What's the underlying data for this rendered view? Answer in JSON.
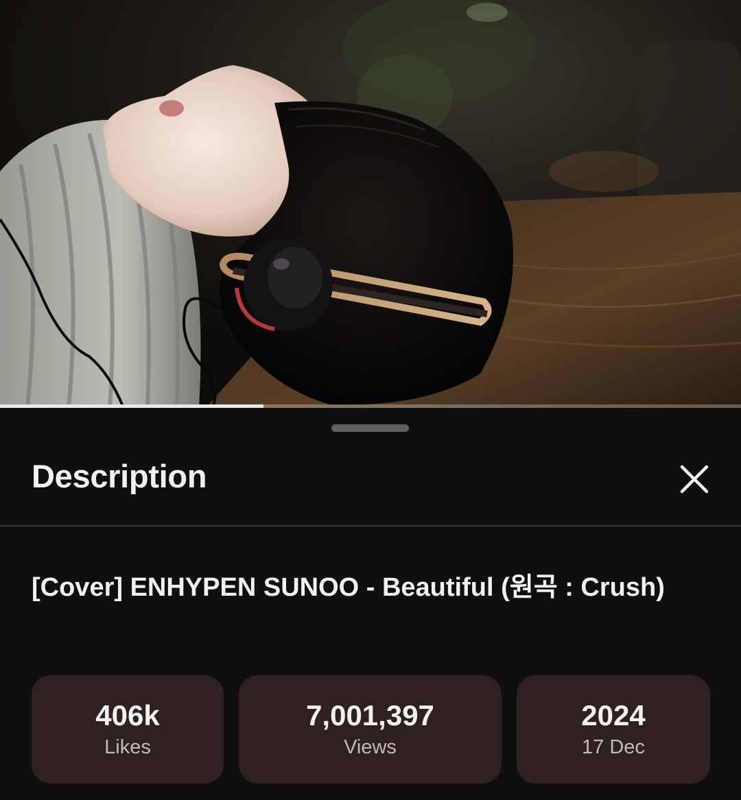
{
  "player": {
    "progress": 0.356,
    "thumbnail_icon": "video-frame-person-with-headphones"
  },
  "sheet": {
    "title": "Description",
    "close_icon": "close-icon"
  },
  "video": {
    "title": "[Cover] ENHYPEN SUNOO - Beautiful (원곡 : Crush)"
  },
  "stats": [
    {
      "value": "406k",
      "label": "Likes"
    },
    {
      "value": "7,001,397",
      "label": "Views"
    },
    {
      "value": "2024",
      "label": "17 Dec"
    }
  ],
  "colors": {
    "background": "#0f0f0f",
    "stat_card": "#2e2120",
    "text_primary": "#f1f1f1",
    "text_secondary": "#bdbdbd",
    "progress_fill": "#e8e8e8"
  }
}
